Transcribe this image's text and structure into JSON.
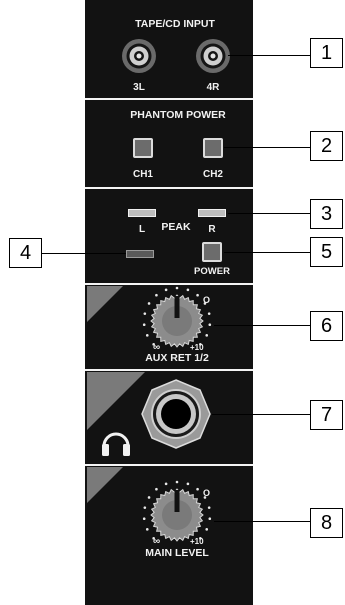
{
  "panel": {
    "tape_cd_input": {
      "title": "TAPE/CD INPUT",
      "left_label": "3L",
      "right_label": "4R"
    },
    "phantom_power": {
      "title": "PHANTOM POWER",
      "ch1_label": "CH1",
      "ch2_label": "CH2"
    },
    "peak": {
      "title": "PEAK",
      "left_label": "L",
      "right_label": "R",
      "power_label": "POWER"
    },
    "aux_return": {
      "label": "AUX RET 1/2",
      "min_label": "∞",
      "zero_label": "O",
      "max_label": "+10"
    },
    "headphones": {
      "icon": "headphones-icon"
    },
    "main_level": {
      "label": "MAIN LEVEL",
      "min_label": "∞",
      "zero_label": "O",
      "max_label": "+10"
    }
  },
  "callouts": [
    "1",
    "2",
    "3",
    "4",
    "5",
    "6",
    "7",
    "8"
  ],
  "colors": {
    "panel": "#121212",
    "text": "#f2f2f2",
    "callout_border": "#000000"
  }
}
